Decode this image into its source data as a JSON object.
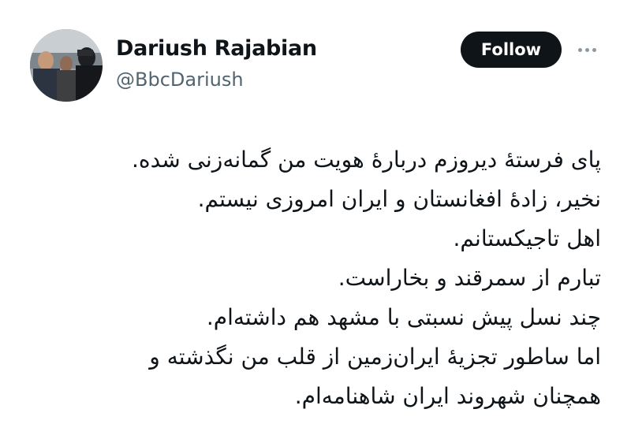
{
  "author": {
    "name": "Dariush Rajabian",
    "handle": "@BbcDariush"
  },
  "follow_label": "Follow",
  "more_icon": "more-horizontal-icon",
  "tweet": {
    "lines": [
      "پای فرستۀ دیروزم دربارۀ هویت من گمانه‌زنی شده.",
      "نخیر، زادۀ افغانستان و ایران امروزی نیستم.",
      "اهل تاجیکستانم.",
      "تبارم از سمرقند و بخاراست.",
      "چند نسل پیش نسبتی با مشهد هم داشته‌ام.",
      "اما ساطور تجزیۀ ایران‌زمین از قلب من نگذشته و",
      "همچنان شهروند ایران شاهنامه‌ام."
    ]
  }
}
